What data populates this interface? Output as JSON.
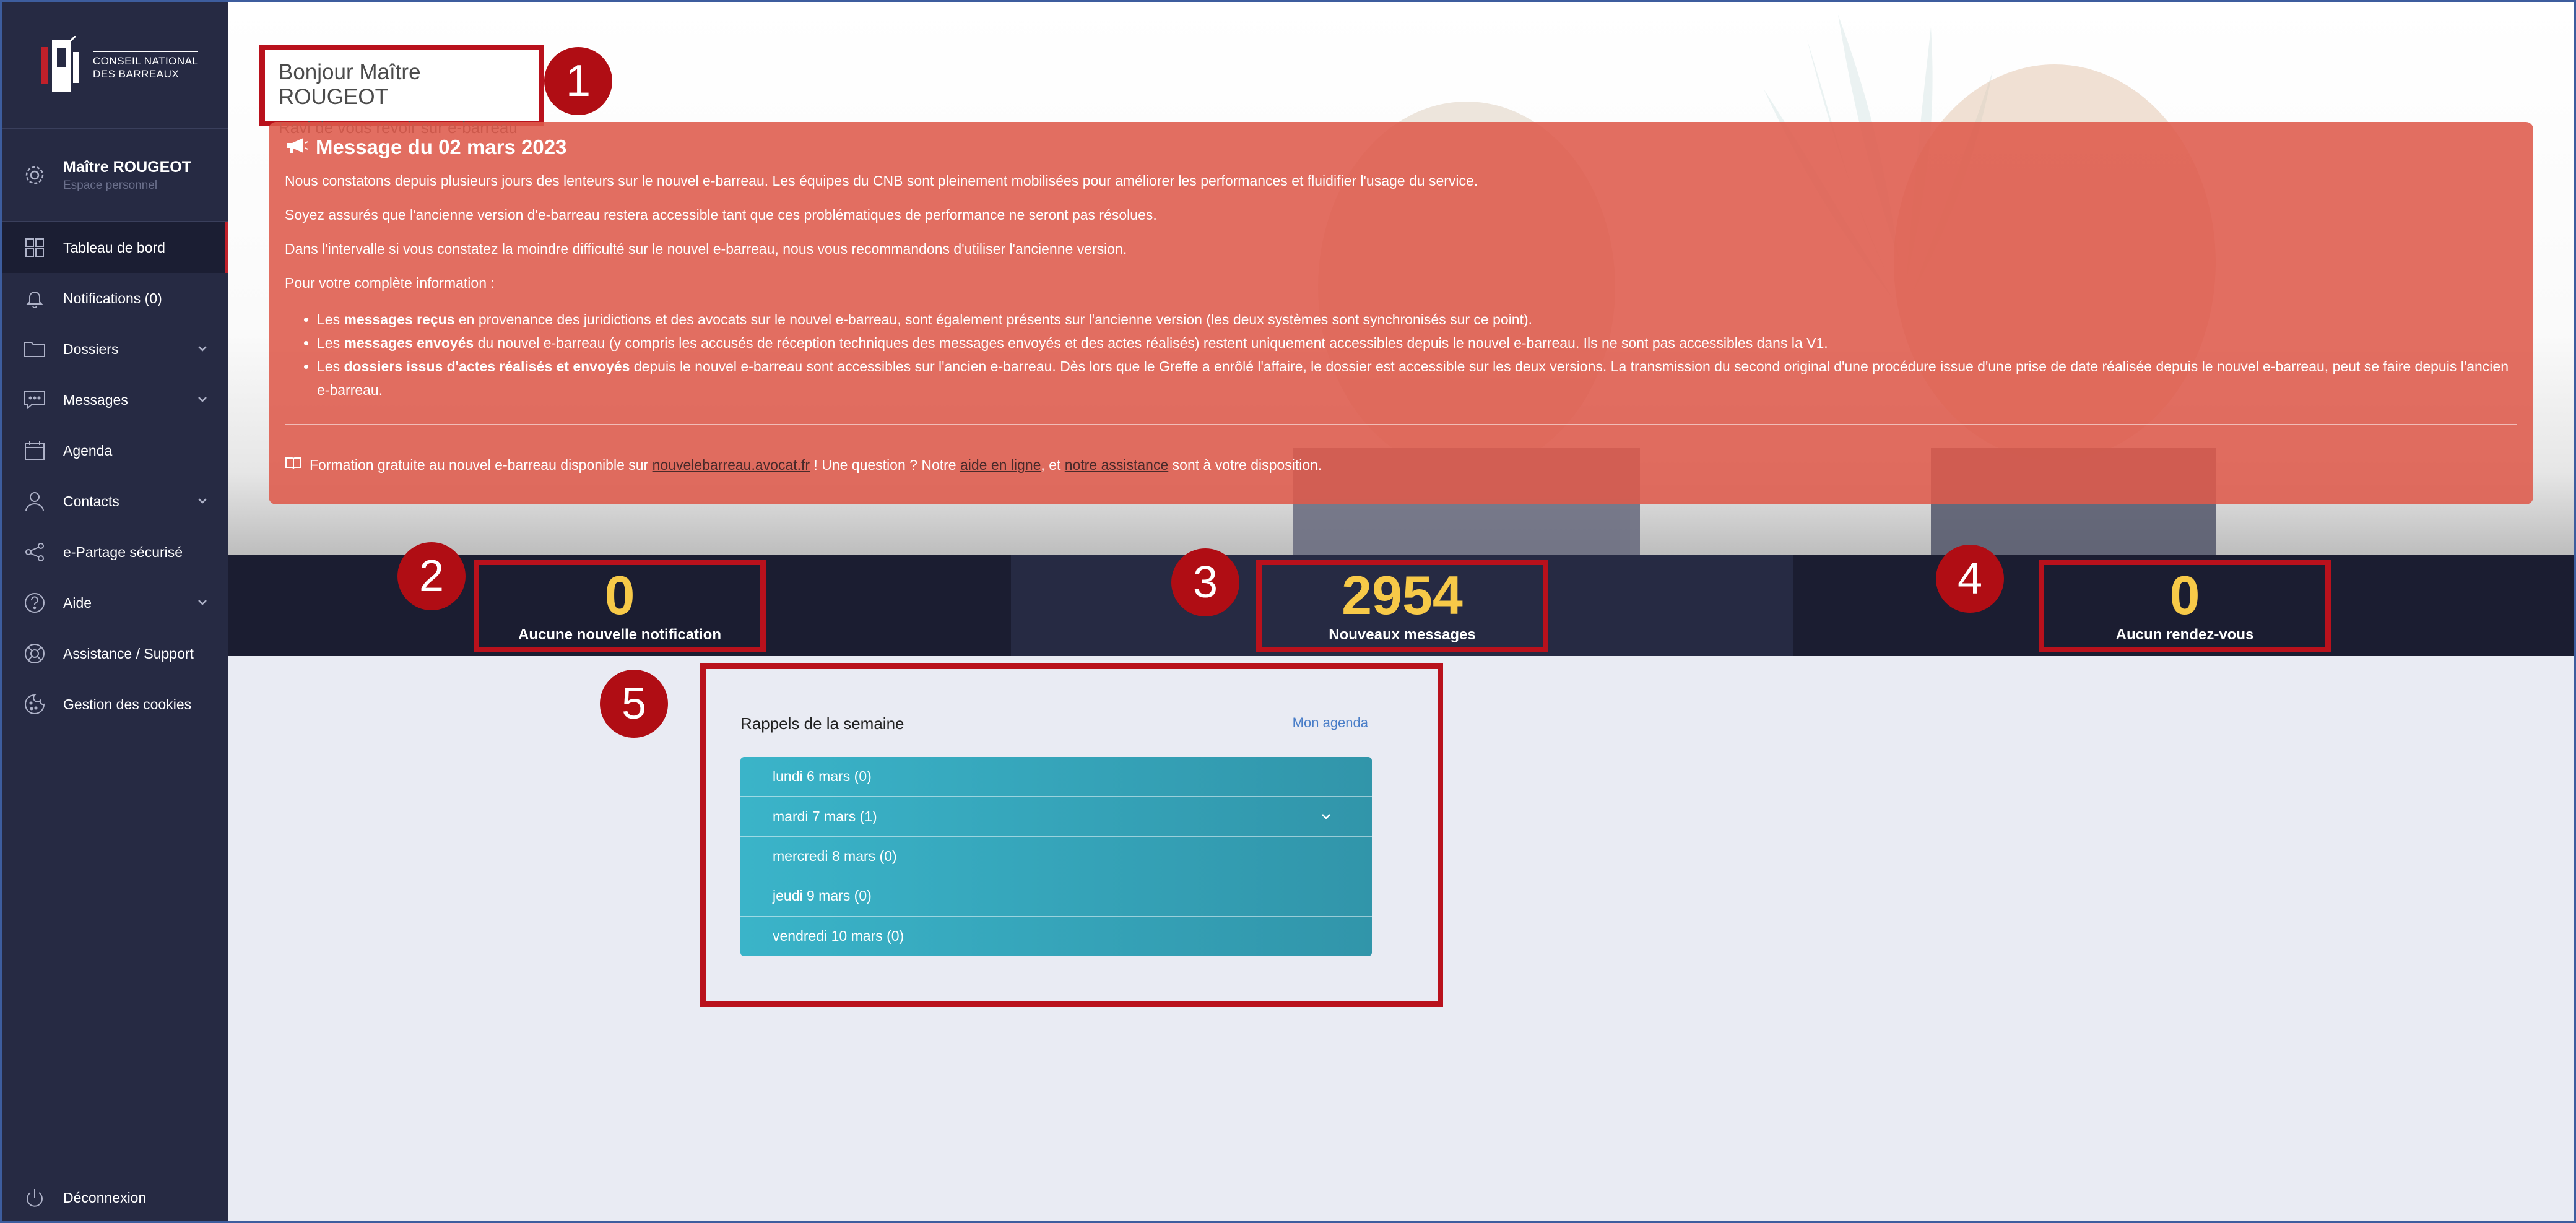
{
  "sidebar": {
    "logo_line1": "CONSEIL NATIONAL",
    "logo_line2": "DES BARREAUX",
    "user_name": "Maître ROUGEOT",
    "user_sub": "Espace personnel",
    "items": [
      {
        "label": "Tableau de bord",
        "icon": "dashboard-icon"
      },
      {
        "label": "Notifications (0)",
        "icon": "bell-icon"
      },
      {
        "label": "Dossiers",
        "icon": "folder-icon"
      },
      {
        "label": "Messages",
        "icon": "message-icon"
      },
      {
        "label": "Agenda",
        "icon": "calendar-icon"
      },
      {
        "label": "Contacts",
        "icon": "user-icon"
      },
      {
        "label": "e-Partage sécurisé",
        "icon": "share-icon"
      },
      {
        "label": "Aide",
        "icon": "help-icon"
      },
      {
        "label": "Assistance / Support",
        "icon": "support-icon"
      },
      {
        "label": "Gestion des cookies",
        "icon": "cookie-icon"
      }
    ],
    "logout": "Déconnexion"
  },
  "greeting": {
    "title": "Bonjour Maître ROUGEOT",
    "subtitle": "Ravi de vous revoir sur e-barreau"
  },
  "alert": {
    "title": "Message du 02 mars 2023",
    "p1": "Nous constatons depuis plusieurs jours des lenteurs sur le nouvel e-barreau. Les équipes du CNB sont pleinement mobilisées pour améliorer les performances et fluidifier l'usage du service.",
    "p2": "Soyez assurés que l'ancienne version d'e-barreau restera accessible tant que ces problématiques de performance ne seront pas résolues.",
    "p3": "Dans l'intervalle si vous constatez la moindre difficulté sur le nouvel e-barreau, nous vous recommandons d'utiliser l'ancienne version.",
    "p4": "Pour votre complète information :",
    "li1_pre": "Les ",
    "li1_bold": "messages reçus",
    "li1_post": " en provenance des juridictions et des avocats sur le nouvel e-barreau, sont également présents sur l'ancienne version (les deux systèmes sont synchronisés sur ce point).",
    "li2_pre": "Les ",
    "li2_bold": "messages envoyés",
    "li2_post": " du nouvel e-barreau (y compris les accusés de réception techniques des messages envoyés et des actes réalisés) restent uniquement accessibles depuis le nouvel e-barreau. Ils ne sont pas accessibles dans la V1.",
    "li3_pre": "Les ",
    "li3_bold": "dossiers issus d'actes réalisés et envoyés",
    "li3_post": " depuis le nouvel e-barreau sont accessibles sur l'ancien e-barreau. Dès lors que le Greffe a enrôlé l'affaire, le dossier est accessible sur les deux versions. La transmission du second original d'une procédure issue d'une prise de date réalisée depuis le nouvel e-barreau, peut se faire depuis l'ancien e-barreau.",
    "foot_pre": "Formation gratuite au nouvel e-barreau disponible sur ",
    "foot_link1": "nouvelebarreau.avocat.fr",
    "foot_mid1": " ! Une question ? Notre ",
    "foot_link2": "aide en ligne",
    "foot_mid2": ", et ",
    "foot_link3": "notre assistance",
    "foot_end": " sont à votre disposition."
  },
  "markers": [
    "1",
    "2",
    "3",
    "4",
    "5"
  ],
  "stats": [
    {
      "value": "0",
      "label": "Aucune nouvelle notification"
    },
    {
      "value": "2954",
      "label": "Nouveaux messages"
    },
    {
      "value": "0",
      "label": "Aucun rendez-vous"
    }
  ],
  "rappels": {
    "title": "Rappels de la semaine",
    "link": "Mon agenda",
    "days": [
      "lundi 6 mars (0)",
      "mardi 7 mars (1)",
      "mercredi 8 mars (0)",
      "jeudi 9 mars (0)",
      "vendredi 10 mars (0)"
    ]
  },
  "colors": {
    "sidebar": "#262a43",
    "accent_red": "#b9111c",
    "alert_bg": "#de5a4b",
    "stat_yellow": "#f7c948",
    "rappel_teal": "#3ab4c9"
  }
}
